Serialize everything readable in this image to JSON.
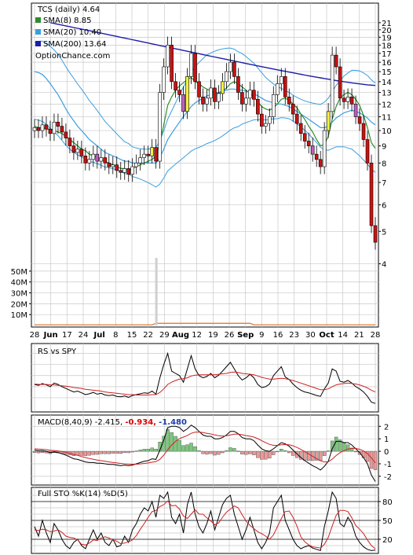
{
  "chart_data": [
    {
      "type": "candlestick",
      "title": "TCS (daily) 4.64",
      "watermark": "OptionChance.com",
      "legend": {
        "placement": "top-left",
        "entries": [
          {
            "label": "TCS (daily) 4.64",
            "color": "#000000"
          },
          {
            "label": "SMA(8) 8.85",
            "color": "#2e8b2e"
          },
          {
            "label": "SMA(20) 10.40",
            "color": "#3a9ee0"
          },
          {
            "label": "SMA(200) 13.64",
            "color": "#1c1ca8"
          }
        ]
      },
      "y_axis": {
        "scale": "log",
        "ticks": [
          "4",
          "5",
          "6",
          "7",
          "8",
          "9",
          "10",
          "11",
          "12",
          "13",
          "14",
          "15",
          "16",
          "17",
          "18",
          "19",
          "20",
          "21"
        ],
        "range": [
          3.7,
          23
        ]
      },
      "volume_axis": {
        "ticks": [
          "50M",
          "40M",
          "30M",
          "20M",
          "10M"
        ]
      },
      "x_axis": {
        "ticks": [
          "28",
          "Jun",
          "17",
          "24",
          "Jul",
          "8",
          "15",
          "22",
          "29",
          "Aug",
          "12",
          "19",
          "26",
          "Sep",
          "9",
          "16",
          "23",
          "30",
          "Oct",
          "14",
          "21",
          "28"
        ],
        "bold_ticks": [
          "Jun",
          "Jul",
          "Aug",
          "Sep",
          "Oct"
        ]
      },
      "close": [
        10.2,
        10.0,
        10.4,
        10.1,
        9.8,
        10.6,
        10.3,
        9.9,
        9.5,
        9.0,
        8.6,
        8.8,
        8.4,
        8.0,
        8.2,
        8.5,
        8.1,
        8.3,
        8.0,
        7.8,
        7.9,
        7.6,
        7.5,
        7.7,
        7.4,
        7.8,
        8.0,
        8.3,
        8.5,
        8.4,
        8.9,
        8.1,
        13.0,
        15.5,
        18.0,
        14.0,
        13.2,
        12.8,
        11.4,
        14.5,
        17.0,
        14.0,
        12.6,
        12.0,
        12.5,
        13.4,
        12.2,
        12.9,
        14.0,
        15.0,
        16.0,
        14.5,
        13.0,
        12.0,
        12.5,
        13.2,
        12.4,
        11.2,
        10.3,
        10.5,
        11.0,
        12.8,
        13.8,
        14.5,
        12.6,
        12.0,
        11.2,
        10.5,
        9.8,
        9.3,
        9.0,
        8.5,
        8.2,
        7.8,
        10.0,
        11.4,
        16.8,
        15.5,
        12.5,
        12.2,
        12.6,
        12.0,
        11.0,
        10.5,
        9.4,
        8.0,
        5.2,
        4.64
      ],
      "sma8": [
        10.3,
        10.2,
        10.2,
        10.1,
        10.1,
        10.0,
        9.9,
        9.8,
        9.6,
        9.4,
        9.2,
        9.0,
        8.8,
        8.7,
        8.5,
        8.4,
        8.3,
        8.2,
        8.1,
        8.0,
        7.9,
        7.8,
        7.7,
        7.7,
        7.6,
        7.7,
        7.8,
        7.9,
        8.0,
        8.1,
        8.2,
        8.4,
        9.2,
        10.4,
        11.9,
        12.6,
        13.2,
        13.6,
        13.9,
        14.2,
        14.4,
        14.0,
        13.8,
        13.5,
        13.3,
        13.1,
        13.0,
        12.9,
        13.1,
        13.4,
        13.8,
        14.0,
        13.8,
        13.5,
        13.2,
        12.9,
        12.6,
        12.2,
        11.8,
        11.6,
        11.5,
        11.7,
        12.0,
        12.4,
        12.5,
        12.3,
        12.0,
        11.7,
        11.2,
        10.8,
        10.3,
        9.9,
        9.4,
        9.0,
        9.1,
        9.6,
        10.8,
        11.8,
        12.5,
        12.8,
        13.0,
        12.8,
        12.4,
        11.9,
        11.1,
        10.2,
        9.2,
        8.85
      ],
      "sma20": [
        15.0,
        14.9,
        14.7,
        14.3,
        13.8,
        13.3,
        12.8,
        12.2,
        11.6,
        11.1,
        10.7,
        10.3,
        10.0,
        9.7,
        9.4,
        9.2,
        9.0,
        8.8,
        8.6,
        8.5,
        8.4,
        8.3,
        8.2,
        8.1,
        8.1,
        8.0,
        8.0,
        8.0,
        8.0,
        8.0,
        8.0,
        8.0,
        8.3,
        8.8,
        9.4,
        9.8,
        10.2,
        10.6,
        11.0,
        11.4,
        11.8,
        12.1,
        12.3,
        12.5,
        12.7,
        12.8,
        12.9,
        13.0,
        13.1,
        13.2,
        13.3,
        13.3,
        13.2,
        13.2,
        13.1,
        13.0,
        12.9,
        12.7,
        12.5,
        12.3,
        12.2,
        12.1,
        12.0,
        12.0,
        11.9,
        11.8,
        11.6,
        11.4,
        11.2,
        11.0,
        10.8,
        10.6,
        10.4,
        10.2,
        10.2,
        10.3,
        10.6,
        10.9,
        11.1,
        11.3,
        11.4,
        11.5,
        11.4,
        11.3,
        11.1,
        10.9,
        10.6,
        10.4
      ],
      "sma200_segment": {
        "start_index": 4,
        "start": 21.0,
        "end": 13.64
      }
    },
    {
      "type": "line",
      "title": "RS vs SPY",
      "series": [
        {
          "name": "RS vs SPY",
          "color": "#000000",
          "values": [
            0.55,
            0.53,
            0.57,
            0.54,
            0.5,
            0.58,
            0.55,
            0.5,
            0.46,
            0.42,
            0.38,
            0.4,
            0.36,
            0.32,
            0.34,
            0.37,
            0.33,
            0.35,
            0.31,
            0.3,
            0.31,
            0.28,
            0.27,
            0.29,
            0.26,
            0.3,
            0.32,
            0.34,
            0.36,
            0.35,
            0.4,
            0.33,
            0.7,
            1.0,
            1.25,
            0.85,
            0.8,
            0.75,
            0.6,
            0.9,
            1.2,
            0.9,
            0.75,
            0.7,
            0.73,
            0.8,
            0.7,
            0.76,
            0.85,
            0.95,
            1.05,
            0.9,
            0.75,
            0.65,
            0.7,
            0.78,
            0.7,
            0.55,
            0.48,
            0.5,
            0.56,
            0.75,
            0.85,
            0.95,
            0.72,
            0.66,
            0.56,
            0.48,
            0.42,
            0.38,
            0.36,
            0.33,
            0.3,
            0.28,
            0.45,
            0.58,
            0.9,
            0.85,
            0.62,
            0.6,
            0.64,
            0.58,
            0.5,
            0.45,
            0.38,
            0.28,
            0.15,
            0.12
          ]
        },
        {
          "name": "average",
          "color": "#cc2222",
          "values": [
            0.56,
            0.55,
            0.55,
            0.55,
            0.54,
            0.54,
            0.53,
            0.52,
            0.51,
            0.5,
            0.48,
            0.47,
            0.46,
            0.44,
            0.43,
            0.42,
            0.41,
            0.4,
            0.38,
            0.37,
            0.36,
            0.35,
            0.34,
            0.33,
            0.32,
            0.32,
            0.31,
            0.31,
            0.31,
            0.31,
            0.32,
            0.32,
            0.37,
            0.45,
            0.55,
            0.6,
            0.64,
            0.67,
            0.68,
            0.7,
            0.74,
            0.76,
            0.77,
            0.77,
            0.77,
            0.77,
            0.77,
            0.78,
            0.79,
            0.8,
            0.82,
            0.83,
            0.82,
            0.8,
            0.79,
            0.78,
            0.77,
            0.74,
            0.71,
            0.69,
            0.67,
            0.67,
            0.68,
            0.69,
            0.68,
            0.66,
            0.64,
            0.61,
            0.58,
            0.55,
            0.52,
            0.49,
            0.46,
            0.43,
            0.43,
            0.45,
            0.5,
            0.54,
            0.56,
            0.57,
            0.58,
            0.57,
            0.56,
            0.54,
            0.51,
            0.47,
            0.42,
            0.38
          ]
        }
      ]
    },
    {
      "type": "line",
      "title": "MACD(8,40,9)",
      "readouts": [
        {
          "text": "-2.415,",
          "color": "#000000"
        },
        {
          "text": "-0.934,",
          "color": "#dd0000"
        },
        {
          "text": "-1.480",
          "color": "#1a3ea8"
        }
      ],
      "y_axis": {
        "ticks": [
          "2",
          "1",
          "0",
          "-1",
          "-2"
        ],
        "range": [
          -2.7,
          2.9
        ]
      },
      "macd": [
        0.1,
        0.05,
        0.05,
        0.0,
        -0.1,
        -0.05,
        -0.1,
        -0.2,
        -0.3,
        -0.45,
        -0.6,
        -0.65,
        -0.75,
        -0.85,
        -0.9,
        -0.9,
        -0.95,
        -0.95,
        -1.0,
        -1.05,
        -1.05,
        -1.1,
        -1.15,
        -1.1,
        -1.15,
        -1.1,
        -1.0,
        -0.9,
        -0.8,
        -0.75,
        -0.6,
        -0.65,
        0.1,
        0.9,
        1.9,
        2.0,
        2.0,
        1.9,
        1.6,
        1.8,
        2.1,
        1.9,
        1.6,
        1.3,
        1.2,
        1.2,
        1.0,
        1.0,
        1.1,
        1.3,
        1.6,
        1.6,
        1.4,
        1.1,
        1.0,
        1.0,
        0.85,
        0.5,
        0.2,
        0.05,
        0.0,
        0.2,
        0.45,
        0.7,
        0.6,
        0.4,
        0.1,
        -0.2,
        -0.5,
        -0.75,
        -0.95,
        -1.15,
        -1.3,
        -1.5,
        -1.2,
        -0.8,
        0.2,
        0.8,
        0.8,
        0.7,
        0.7,
        0.5,
        0.2,
        -0.1,
        -0.5,
        -1.0,
        -1.9,
        -2.415
      ],
      "signal": [
        0.2,
        0.18,
        0.16,
        0.13,
        0.09,
        0.06,
        0.03,
        -0.02,
        -0.08,
        -0.16,
        -0.25,
        -0.33,
        -0.42,
        -0.5,
        -0.58,
        -0.64,
        -0.7,
        -0.75,
        -0.8,
        -0.85,
        -0.89,
        -0.93,
        -0.97,
        -1.0,
        -1.03,
        -1.04,
        -1.03,
        -1.01,
        -0.97,
        -0.93,
        -0.87,
        -0.83,
        -0.64,
        -0.31,
        0.13,
        0.5,
        0.8,
        1.02,
        1.14,
        1.27,
        1.44,
        1.53,
        1.54,
        1.5,
        1.44,
        1.39,
        1.31,
        1.25,
        1.22,
        1.24,
        1.31,
        1.37,
        1.38,
        1.33,
        1.26,
        1.21,
        1.14,
        1.01,
        0.85,
        0.69,
        0.55,
        0.48,
        0.48,
        0.52,
        0.54,
        0.52,
        0.44,
        0.31,
        0.15,
        -0.03,
        -0.21,
        -0.4,
        -0.58,
        -0.76,
        -0.85,
        -0.84,
        -0.63,
        -0.34,
        -0.11,
        0.05,
        0.18,
        0.24,
        0.23,
        0.16,
        0.03,
        -0.18,
        -0.52,
        -0.934
      ]
    },
    {
      "type": "line",
      "title": "Full STO %K(14) %D(5)",
      "y_axis": {
        "ticks": [
          "80",
          "50",
          "20"
        ],
        "range": [
          0,
          100
        ]
      },
      "series": [
        {
          "name": "%K(14)",
          "color": "#000000",
          "values": [
            40,
            25,
            50,
            30,
            15,
            45,
            35,
            20,
            10,
            5,
            15,
            20,
            10,
            5,
            20,
            35,
            20,
            30,
            15,
            10,
            20,
            8,
            10,
            25,
            15,
            35,
            45,
            60,
            70,
            65,
            80,
            55,
            90,
            85,
            95,
            55,
            45,
            60,
            30,
            75,
            95,
            60,
            40,
            30,
            45,
            65,
            35,
            55,
            75,
            85,
            90,
            60,
            40,
            20,
            35,
            55,
            35,
            15,
            5,
            15,
            30,
            70,
            80,
            90,
            50,
            35,
            20,
            10,
            5,
            8,
            10,
            6,
            4,
            2,
            40,
            65,
            95,
            85,
            45,
            40,
            55,
            45,
            25,
            15,
            8,
            4,
            2,
            3
          ]
        },
        {
          "name": "%D(5)",
          "color": "#cc2222",
          "values": [
            35,
            34,
            36,
            35,
            32,
            33,
            35,
            31,
            25,
            23,
            22,
            19,
            12,
            11,
            14,
            19,
            18,
            22,
            24,
            22,
            19,
            17,
            13,
            14,
            16,
            19,
            26,
            36,
            45,
            55,
            64,
            66,
            72,
            75,
            81,
            73,
            74,
            68,
            57,
            53,
            60,
            67,
            60,
            60,
            54,
            49,
            43,
            46,
            55,
            63,
            68,
            73,
            70,
            59,
            49,
            42,
            37,
            32,
            29,
            25,
            20,
            27,
            40,
            53,
            64,
            65,
            55,
            41,
            24,
            16,
            11,
            8,
            7,
            6,
            12,
            23,
            41,
            58,
            66,
            66,
            64,
            54,
            42,
            36,
            29,
            19,
            10,
            5
          ]
        }
      ]
    }
  ]
}
